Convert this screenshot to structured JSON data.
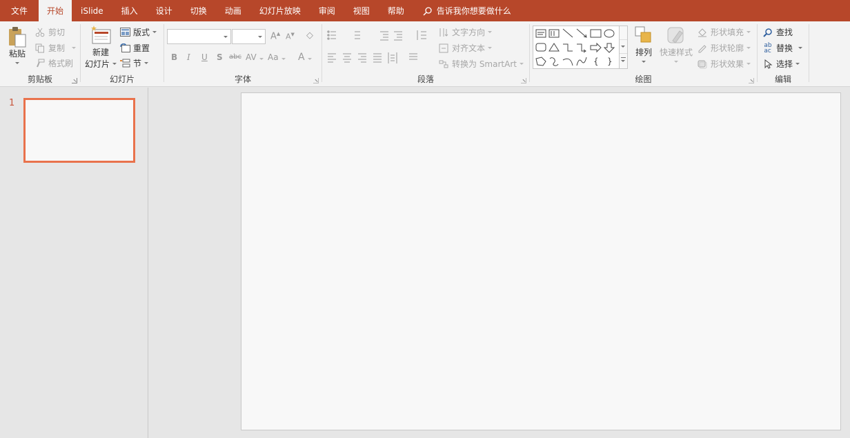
{
  "tabs": [
    {
      "label": "文件",
      "active": false
    },
    {
      "label": "开始",
      "active": true
    },
    {
      "label": "iSlide",
      "active": false
    },
    {
      "label": "插入",
      "active": false
    },
    {
      "label": "设计",
      "active": false
    },
    {
      "label": "切换",
      "active": false
    },
    {
      "label": "动画",
      "active": false
    },
    {
      "label": "幻灯片放映",
      "active": false
    },
    {
      "label": "审阅",
      "active": false
    },
    {
      "label": "视图",
      "active": false
    },
    {
      "label": "帮助",
      "active": false
    }
  ],
  "tell_me": "告诉我你想要做什么",
  "clipboard": {
    "label": "剪贴板",
    "paste": "粘贴",
    "cut": "剪切",
    "copy": "复制",
    "format_painter": "格式刷"
  },
  "slides": {
    "label": "幻灯片",
    "new_slide_line1": "新建",
    "new_slide_line2": "幻灯片",
    "layout": "版式",
    "reset": "重置",
    "section": "节"
  },
  "font": {
    "label": "字体",
    "bold": "B",
    "italic": "I",
    "underline": "U",
    "shadow": "S",
    "strike": "abc",
    "spacing": "AV",
    "case": "Aa",
    "color": "A",
    "grow": "A",
    "shrink": "A"
  },
  "paragraph": {
    "label": "段落",
    "text_direction": "文字方向",
    "align_text": "对齐文本",
    "convert_smartart": "转换为 SmartArt"
  },
  "drawing": {
    "label": "绘图",
    "arrange": "排列",
    "quick_styles": "快速样式",
    "shape_fill": "形状填充",
    "shape_outline": "形状轮廓",
    "shape_effects": "形状效果"
  },
  "editing": {
    "label": "编辑",
    "find": "查找",
    "replace": "替换",
    "select": "选择"
  },
  "slide_number": "1",
  "colors": {
    "accent": "#b7472a",
    "thumb_border": "#e9724c"
  }
}
